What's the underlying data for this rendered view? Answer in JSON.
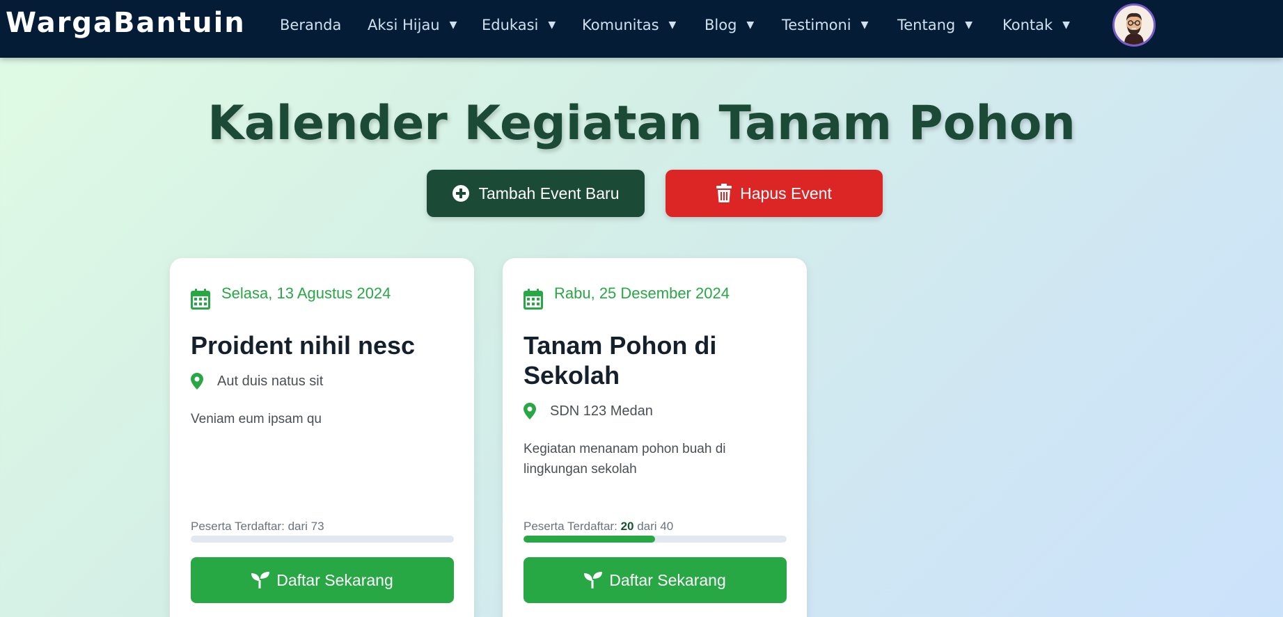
{
  "nav": {
    "brand": "WargaBantuin",
    "items": [
      {
        "label": "Beranda",
        "dropdown": false
      },
      {
        "label": "Aksi Hijau",
        "dropdown": true
      },
      {
        "label": "Edukasi",
        "dropdown": true
      },
      {
        "label": "Komunitas",
        "dropdown": true
      },
      {
        "label": "Blog",
        "dropdown": true
      },
      {
        "label": "Testimoni",
        "dropdown": true
      },
      {
        "label": "Tentang",
        "dropdown": true
      },
      {
        "label": "Kontak",
        "dropdown": true
      }
    ],
    "caret": "▼",
    "avatar_icon": "user-avatar"
  },
  "header": {
    "title": "Kalender Kegiatan Tanam Pohon",
    "add_button": "Tambah Event Baru",
    "delete_button": "Hapus Event"
  },
  "cards": [
    {
      "date": "Selasa, 13 Agustus 2024",
      "title": "Proident nihil nesc",
      "location": "Aut duis natus sit",
      "description": "Veniam eum ipsam qu",
      "participants_label": "Peserta Terdaftar:",
      "registered": "",
      "capacity_text": "dari 73",
      "progress_fraction": 0,
      "button": "Daftar Sekarang"
    },
    {
      "date": "Rabu, 25 Desember 2024",
      "title": "Tanam Pohon di Sekolah",
      "location": "SDN 123 Medan",
      "description": "Kegiatan menanam pohon buah di lingkungan sekolah",
      "participants_label": "Peserta Terdaftar:",
      "registered": "20",
      "capacity_text": "dari 40",
      "progress_fraction": 0.5,
      "button": "Daftar Sekarang"
    }
  ],
  "colors": {
    "nav_bg": "#041c36",
    "title": "#1b4a36",
    "add_button": "#1b4a36",
    "delete_button": "#dc2626",
    "accent_green": "#28a745"
  }
}
